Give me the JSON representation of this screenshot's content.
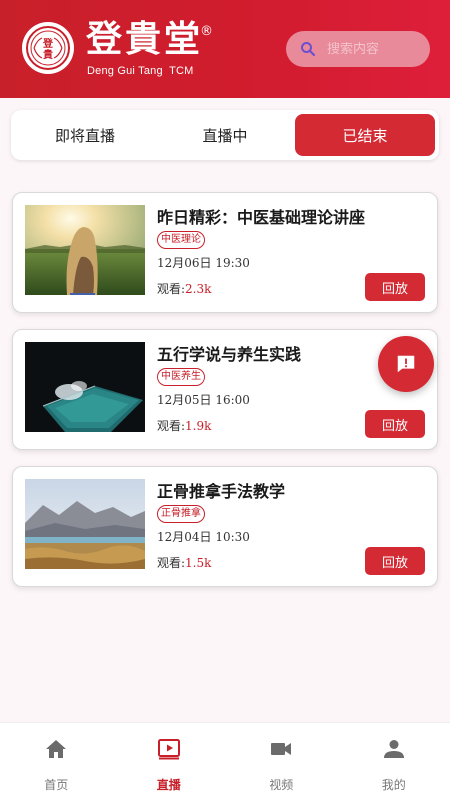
{
  "colors": {
    "brand": "#c8202a",
    "accent": "#d42a34",
    "background": "#fdf6f8"
  },
  "header": {
    "brand_cn": "登貴堂",
    "registered": "®",
    "brand_en": "Deng Gui Tang  TCM",
    "logo_text": "登貴",
    "search": {
      "placeholder": "搜索内容",
      "icon": "search-icon"
    }
  },
  "tabs": [
    {
      "label": "即将直播",
      "active": false
    },
    {
      "label": "直播中",
      "active": false
    },
    {
      "label": "已结束",
      "active": true
    }
  ],
  "cards": [
    {
      "title": "昨日精彩：中医基础理论讲座",
      "tag": "中医理论",
      "time": "12月06日 19:30",
      "views_label": "观看:",
      "views": "2.3k",
      "button": "回放",
      "thumb": "sunset-field-photo"
    },
    {
      "title": "五行学说与养生实践",
      "tag": "中医养生",
      "time": "12月05日 16:00",
      "views_label": "观看:",
      "views": "1.9k",
      "button": "回放",
      "thumb": "ocean-pool-photo"
    },
    {
      "title": "正骨推拿手法教学",
      "tag": "正骨推拿",
      "time": "12月04日 10:30",
      "views_label": "观看:",
      "views": "1.5k",
      "button": "回放",
      "thumb": "mountain-lake-photo"
    }
  ],
  "fab": {
    "icon": "feedback-icon"
  },
  "bottom_nav": [
    {
      "label": "首页",
      "icon": "home-icon",
      "active": false
    },
    {
      "label": "直播",
      "icon": "live-play-icon",
      "active": true
    },
    {
      "label": "视频",
      "icon": "video-camera-icon",
      "active": false
    },
    {
      "label": "我的",
      "icon": "person-icon",
      "active": false
    }
  ]
}
